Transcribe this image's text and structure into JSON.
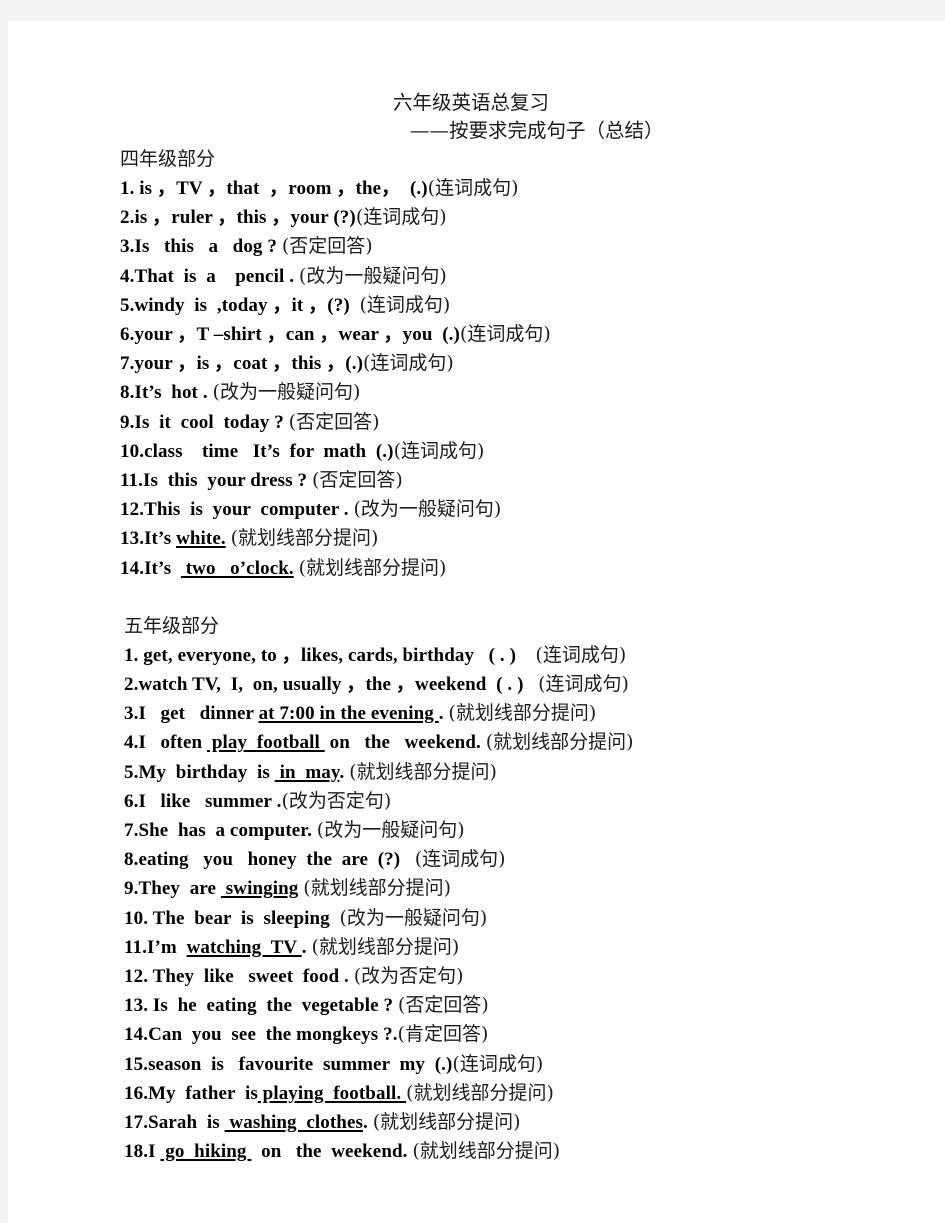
{
  "document": {
    "title": "六年级英语总复习",
    "subtitle": "——按要求完成句子（总结）"
  },
  "sections": [
    {
      "heading": "四年级部分",
      "items": [
        {
          "number": "1.",
          "en_before": " is ，TV ，that  ，room ，the，  (.)",
          "underline": "",
          "en_after": "",
          "cn": "(连词成句)"
        },
        {
          "number": "2.",
          "en_before": "is ，ruler ，this ，your (?)",
          "underline": "",
          "en_after": "",
          "cn": "(连词成句)"
        },
        {
          "number": "3.",
          "en_before": "Is   this   a   dog ? ",
          "underline": "",
          "en_after": "",
          "cn": "(否定回答)"
        },
        {
          "number": "4.",
          "en_before": "That  is  a    pencil . ",
          "underline": "",
          "en_after": "",
          "cn": "(改为一般疑问句)"
        },
        {
          "number": "5.",
          "en_before": "windy  is  ,today ，it ，(?)  ",
          "underline": "",
          "en_after": "",
          "cn": "(连词成句)"
        },
        {
          "number": "6.",
          "en_before": "your ，T –shirt ，can ，wear ，you  (.)",
          "underline": "",
          "en_after": "",
          "cn": "(连词成句)"
        },
        {
          "number": "7.",
          "en_before": "your ，is ，coat ，this ，(.)",
          "underline": "",
          "en_after": "",
          "cn": "(连词成句)"
        },
        {
          "number": "8.",
          "en_before": "It’s  hot . ",
          "underline": "",
          "en_after": "",
          "cn": "(改为一般疑问句)"
        },
        {
          "number": "9.",
          "en_before": "Is  it  cool  today ? ",
          "underline": "",
          "en_after": "",
          "cn": "(否定回答)"
        },
        {
          "number": "10.",
          "en_before": "class    time   It’s  for  math  (.)",
          "underline": "",
          "en_after": "",
          "cn": "(连词成句)"
        },
        {
          "number": "11.",
          "en_before": "Is  this  your dress ? ",
          "underline": "",
          "en_after": "",
          "cn": "(否定回答)"
        },
        {
          "number": "12.",
          "en_before": "This  is  your  computer . ",
          "underline": "",
          "en_after": "",
          "cn": "(改为一般疑问句)"
        },
        {
          "number": "13.",
          "en_before": "It’s ",
          "underline": "white.",
          "en_after": " ",
          "cn": "(就划线部分提问)"
        },
        {
          "number": "14.",
          "en_before": "It’s  ",
          "underline": " two   o’clock.",
          "en_after": " ",
          "cn": "(就划线部分提问)"
        }
      ]
    },
    {
      "heading": "五年级部分",
      "items": [
        {
          "number": "1.",
          "en_before": " get, everyone, to ，likes, cards, birthday   ( . )    ",
          "underline": "",
          "en_after": "",
          "cn": "(连词成句)"
        },
        {
          "number": "2.",
          "en_before": "watch TV,  I,  on, usually ，the ，weekend  ( . )   ",
          "underline": "",
          "en_after": "",
          "cn": "(连词成句)"
        },
        {
          "number": "3.",
          "en_before": "I   get   dinner ",
          "underline": "at 7:00 in the evening ",
          "en_after": ". ",
          "cn": "(就划线部分提问)"
        },
        {
          "number": "4.",
          "en_before": "I   often ",
          "underline": " play  football ",
          "en_after": " on   the   weekend. ",
          "cn": "(就划线部分提问)"
        },
        {
          "number": "5.",
          "en_before": "My  birthday  is ",
          "underline": " in  may",
          "en_after": ". ",
          "cn": "(就划线部分提问)"
        },
        {
          "number": "6.",
          "en_before": "I   like   summer .",
          "underline": "",
          "en_after": "",
          "cn": "(改为否定句)"
        },
        {
          "number": "7.",
          "en_before": "She  has  a computer. ",
          "underline": "",
          "en_after": "",
          "cn": "(改为一般疑问句)"
        },
        {
          "number": "8.",
          "en_before": "eating   you   honey  the  are  (?)   ",
          "underline": "",
          "en_after": "",
          "cn": "(连词成句)"
        },
        {
          "number": "9.",
          "en_before": "They  are ",
          "underline": " swinging",
          "en_after": " ",
          "cn": "(就划线部分提问)"
        },
        {
          "number": "10.",
          "en_before": " The  bear  is  sleeping  ",
          "underline": "",
          "en_after": "",
          "cn": "(改为一般疑问句)"
        },
        {
          "number": "11.",
          "en_before": "I’m  ",
          "underline": "watching  TV ",
          "en_after": ". ",
          "cn": "(就划线部分提问)"
        },
        {
          "number": "12.",
          "en_before": " They  like   sweet  food . ",
          "underline": "",
          "en_after": "",
          "cn": "(改为否定句)"
        },
        {
          "number": "13.",
          "en_before": " Is  he  eating  the  vegetable ? ",
          "underline": "",
          "en_after": "",
          "cn": "(否定回答)"
        },
        {
          "number": "14.",
          "en_before": "Can  you  see  the mongkeys ?.",
          "underline": "",
          "en_after": "",
          "cn": "(肯定回答)"
        },
        {
          "number": "15.",
          "en_before": "season  is   favourite  summer  my  (.)",
          "underline": "",
          "en_after": "",
          "cn": "(连词成句)"
        },
        {
          "number": "16.",
          "en_before": "My  father  is",
          "underline": " playing  football. ",
          "en_after": "",
          "cn": "(就划线部分提问)"
        },
        {
          "number": "17.",
          "en_before": "Sarah  is ",
          "underline": " washing  clothes",
          "en_after": ". ",
          "cn": "(就划线部分提问)"
        },
        {
          "number": "18.",
          "en_before": "I ",
          "underline": " go  hiking ",
          "en_after": "  on   the  weekend. ",
          "cn": "(就划线部分提问)"
        }
      ]
    }
  ]
}
